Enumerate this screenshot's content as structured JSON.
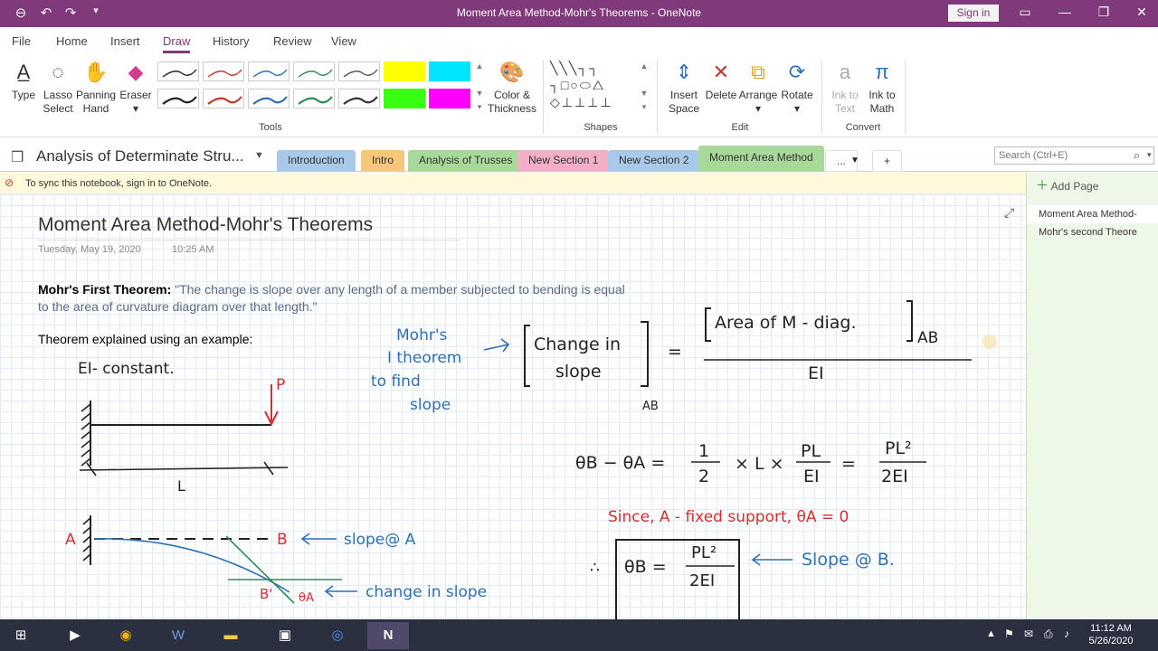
{
  "window": {
    "title": "Moment Area Method-Mohr's Theorems  -  OneNote",
    "sign_in": "Sign in"
  },
  "menu": {
    "tabs": [
      "File",
      "Home",
      "Insert",
      "Draw",
      "History",
      "Review",
      "View"
    ],
    "active": "Draw"
  },
  "ribbon": {
    "tools": {
      "type": "Type",
      "lasso": [
        "Lasso",
        "Select"
      ],
      "panning": [
        "Panning",
        "Hand"
      ],
      "eraser": "Eraser",
      "color": [
        "Color &",
        "Thickness"
      ],
      "group": "Tools"
    },
    "shapes": {
      "group": "Shapes"
    },
    "edit": {
      "insert_space": [
        "Insert",
        "Space"
      ],
      "delete": "Delete",
      "arrange": "Arrange",
      "rotate": "Rotate",
      "group": "Edit"
    },
    "convert": {
      "ink_to_text": [
        "Ink to",
        "Text"
      ],
      "ink_to_math": [
        "Ink to",
        "Math"
      ],
      "group": "Convert"
    },
    "pen_colors": [
      "#222222",
      "#c0392b",
      "#2e6fb5",
      "#2e8b57",
      "#555555",
      "#ffff00",
      "#00e5ff",
      "#222222",
      "#c0392b",
      "#2e6fb5",
      "#2e8b57",
      "#333333",
      "#39ff14",
      "#ff00ff"
    ]
  },
  "notebook": {
    "name": "Analysis of Determinate Stru...",
    "sections": [
      {
        "label": "Introduction",
        "color": "#a9c9e8"
      },
      {
        "label": "Intro",
        "color": "#f7c87a"
      },
      {
        "label": "Analysis of Trusses",
        "color": "#a8d89a"
      },
      {
        "label": "New Section 1",
        "color": "#f1b0c8"
      },
      {
        "label": "New Section 2",
        "color": "#a9c9e8"
      },
      {
        "label": "Moment Area Method",
        "color": "#a8d89a"
      }
    ],
    "more": "...",
    "add": "+",
    "search_placeholder": "Search (Ctrl+E)"
  },
  "banner": "To sync this notebook, sign in to OneNote.",
  "pages": {
    "add_page": "Add Page",
    "items": [
      "Moment Area Method-",
      "Mohr's second Theore"
    ]
  },
  "page": {
    "title": "Moment Area Method-Mohr's Theorems",
    "date": "Tuesday, May 19, 2020",
    "time": "10:25 AM",
    "theorem_label": "Mohr's First Theorem:",
    "theorem_text": "\"The change is slope over any length of a member subjected to bending is equal to the area of curvature diagram over that length.\"",
    "example": "Theorem explained using an example:"
  },
  "ink": {
    "ei_const": "EI- constant.",
    "p": "P",
    "l": "L",
    "a": "A",
    "b": "B",
    "b_prime": "B'",
    "slope_a": "slope@ A",
    "change_slope": "change in slope",
    "mohrs": [
      "Mohr's",
      "I theorem",
      "to find",
      "slope"
    ],
    "change_in": "Change in",
    "slope_word": "slope",
    "ab_sub": "AB",
    "area_m": "Area of  M - diag.",
    "ab2": "AB",
    "ei": "EI",
    "eq_lhs": "θB − θA  =",
    "one": "1",
    "two": "2",
    "times_l": "× L ×",
    "pl": "PL",
    "ei2": "EI",
    "eq2": "=",
    "pl2": "PL²",
    "two_ei": "2EI",
    "since": "Since, A - fixed support, θA = 0",
    "therefore": "∴",
    "thetab": "θB =",
    "pl3": "PL²",
    "two_ei2": "2EI",
    "slope_b": "Slope @ B.",
    "equals": "=",
    "theta_a_lbl": "θA"
  },
  "taskbar": {
    "time": "11:12 AM",
    "date": "5/26/2020"
  }
}
